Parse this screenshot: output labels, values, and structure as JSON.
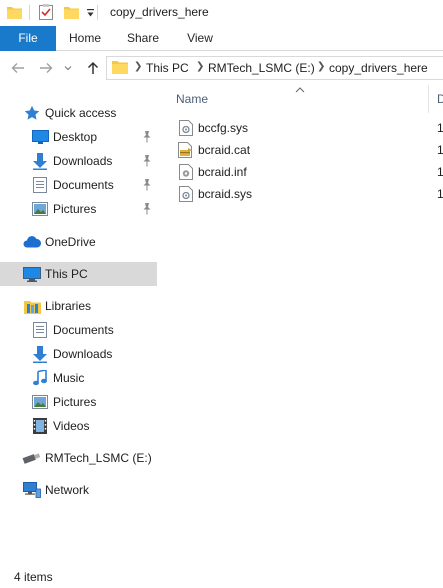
{
  "window": {
    "title": "copy_drivers_here"
  },
  "quick_access_toolbar": [
    {
      "icon": "folder-icon"
    },
    {
      "icon": "properties-check-icon"
    },
    {
      "icon": "new-folder-icon"
    },
    {
      "icon": "customize-dropdown-icon"
    }
  ],
  "ribbon": {
    "tabs": [
      {
        "label": "File",
        "active": true
      },
      {
        "label": "Home"
      },
      {
        "label": "Share"
      },
      {
        "label": "View"
      }
    ]
  },
  "address_bar": {
    "breadcrumb": [
      "This PC",
      "RMTech_LSMC (E:)",
      "copy_drivers_here"
    ]
  },
  "navigation_pane": {
    "items": [
      {
        "label": "Quick access",
        "icon": "star-icon",
        "level": 0
      },
      {
        "label": "Desktop",
        "icon": "desktop-icon",
        "level": 1,
        "pinned": true
      },
      {
        "label": "Downloads",
        "icon": "download-arrow-icon",
        "level": 1,
        "pinned": true
      },
      {
        "label": "Documents",
        "icon": "documents-icon",
        "level": 1,
        "pinned": true
      },
      {
        "label": "Pictures",
        "icon": "pictures-icon",
        "level": 1,
        "pinned": true
      },
      {
        "label": "OneDrive",
        "icon": "cloud-icon",
        "level": 0
      },
      {
        "label": "This PC",
        "icon": "computer-icon",
        "level": 0,
        "selected": true
      },
      {
        "label": "Libraries",
        "icon": "libraries-icon",
        "level": 0
      },
      {
        "label": "Documents",
        "icon": "documents-icon",
        "level": 1
      },
      {
        "label": "Downloads",
        "icon": "download-arrow-icon",
        "level": 1
      },
      {
        "label": "Music",
        "icon": "music-note-icon",
        "level": 1
      },
      {
        "label": "Pictures",
        "icon": "pictures-icon",
        "level": 1
      },
      {
        "label": "Videos",
        "icon": "video-film-icon",
        "level": 1
      },
      {
        "label": "RMTech_LSMC (E:)",
        "icon": "usb-drive-icon",
        "level": 0
      },
      {
        "label": "Network",
        "icon": "network-icon",
        "level": 0
      }
    ]
  },
  "file_list": {
    "columns": {
      "name": "Name",
      "date": "D"
    },
    "files": [
      {
        "name": "bccfg.sys",
        "date": "1",
        "icon": "system-file-icon"
      },
      {
        "name": "bcraid.cat",
        "date": "1",
        "icon": "security-catalog-icon"
      },
      {
        "name": "bcraid.inf",
        "date": "1",
        "icon": "setup-info-icon"
      },
      {
        "name": "bcraid.sys",
        "date": "1",
        "icon": "system-file-icon"
      }
    ]
  },
  "status_bar": {
    "item_count": "4 items"
  },
  "colors": {
    "accent": "#1979ca",
    "selection": "#d9d9d9",
    "folder": "#f5c843",
    "header_text": "#4c607a"
  }
}
